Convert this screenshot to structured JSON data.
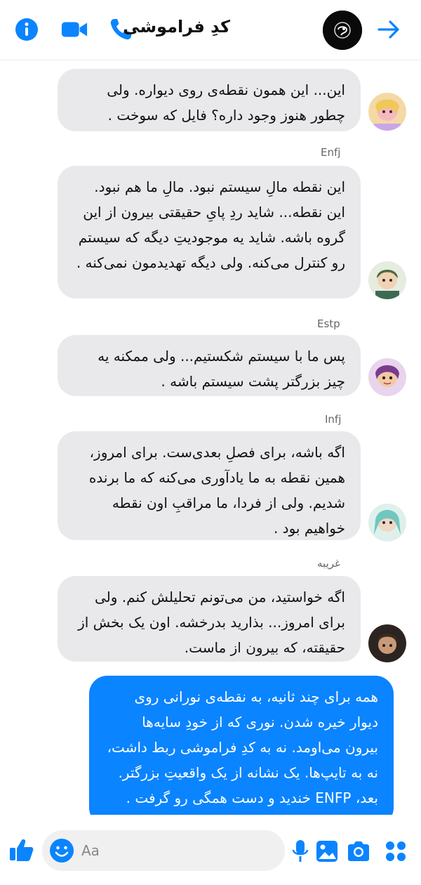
{
  "header": {
    "title": "کدِ فراموشی",
    "icons": [
      "info-icon",
      "video-call-icon",
      "phone-icon",
      "forward-arrow-icon"
    ],
    "accent": "#0a84ff"
  },
  "messages": [
    {
      "sender": "",
      "text": "این... این همون نقطه‌ی روی دیواره. ولی چطور هنوز وجود داره؟ فایل که سوخت ."
    },
    {
      "sender": "Enfj",
      "text": "این نقطه مالِ سیستم نبود. مالِ ما هم نبود. این نقطه... شاید ردِ پایِ حقیقتی بیرون از این گروه باشه. شاید یه موجودیتِ دیگه که سیستم رو کنترل می‌کنه. ولی دیگه تهدیدمون نمی‌کنه ."
    },
    {
      "sender": "Estp",
      "text": "پس ما با سیستم شکستیم... ولی ممکنه یه چیز بزرگتر پشت سیستم باشه ."
    },
    {
      "sender": "Infj",
      "text": "اگه باشه، برای فصلِ بعدی‌ست. برای امروز، همین نقطه به ما یادآوری می‌کنه که ما برنده شدیم. ولی از فردا، ما مراقبِ اون نقطه خواهیم بود ."
    },
    {
      "sender": "غریبه",
      "text": "اگه خواستید، من می‌تونم تحلیلش کنم. ولی برای امروز... بذارید بدرخشه. اون یک بخش از حقیقته، که بیرون از ماست."
    },
    {
      "sender": "",
      "text": "همه برای چند ثانیه، به نقطه‌ی نورانی روی دیوار خیره شدن. نوری که از خودِ سایه‌ها بیرون می‌اومد. نه به کدِ فراموشی ربط داشت، نه به تایپ‌ها. یک نشانه از یک واقعیتِ بزرگتر. بعد، ENFP خندید و دست همگی رو گرفت ."
    }
  ],
  "composer": {
    "placeholder": "Aa"
  },
  "footer_icons": [
    "thumbs-up-icon",
    "emoji-icon",
    "microphone-icon",
    "image-icon",
    "camera-icon",
    "apps-icon"
  ],
  "colors": {
    "accent": "#0a84ff",
    "bubble_gray": "#e9e9eb"
  }
}
